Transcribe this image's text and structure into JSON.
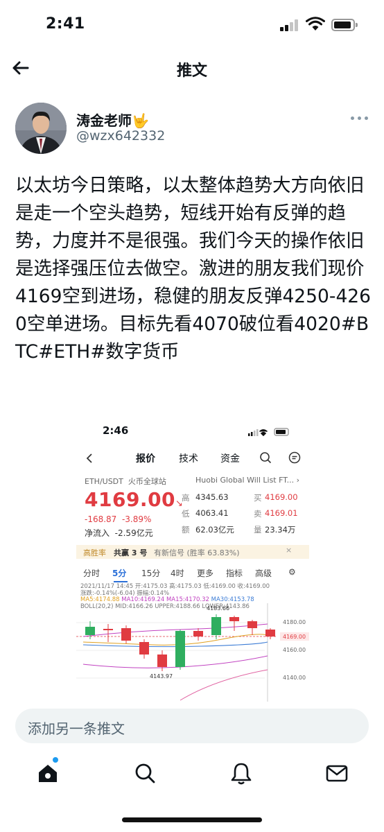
{
  "status_bar": {
    "time": "2:41"
  },
  "header": {
    "title": "推文"
  },
  "author": {
    "name": "涛金老师🤟",
    "handle": "@wzx642332"
  },
  "tweet": {
    "text": "以太坊今日策略，以太整体趋势大方向依旧是走一个空头趋势，短线开始有反弹的趋势，力度并不是很强。我们今天的操作依旧是选择强压位去做空。激进的朋友我们现价4169空到进场，稳健的朋友反弹4250-4260空单进场。目标先看4070破位看4020#BTC#ETH#数字货币"
  },
  "embedded_screenshot": {
    "time": "2:46",
    "nav": {
      "quote": "报价",
      "tech": "技术",
      "funds": "资金"
    },
    "pair": "ETH/USDT",
    "exchange": "火币全球站",
    "right_pair": "Huobi Global Will List FT...",
    "price": "4169.00",
    "price_arrow": "↘",
    "change_abs": "-168.87",
    "change_pct": "-3.89%",
    "inflow_label": "净流入",
    "inflow_value": "-2.59亿元",
    "stats": {
      "high_label": "高",
      "high": "4345.63",
      "buy_label": "买",
      "buy": "4169.00",
      "low_label": "低",
      "low": "4063.41",
      "sell_label": "卖",
      "sell": "4169.01",
      "amount_label": "额",
      "amount": "62.03亿元",
      "volume_label": "量",
      "volume": "23.34万"
    },
    "banner": {
      "tag": "高胜率",
      "text": "共赢 3 号",
      "note": "有新信号 (胜率 63.83%)"
    },
    "tabs": [
      "分时",
      "5分",
      "15分",
      "4时",
      "更多",
      "指标",
      "高级"
    ],
    "active_tab": "5分",
    "info_line1": "2021/11/17 14:45 开:4175.03 高:4175.03 低:4169.00 收:4169.00",
    "info_line2": "涨跌:-0.14%(-6.04) 振幅:0.14%",
    "info_ma5": "MA5:4174.88",
    "info_ma10": "MA10:4169.24",
    "info_ma15": "MA15:4170.32",
    "info_ma30": "MA30:4153.78",
    "info_boll": "BOLL(20,2) MID:4166.26 UPPER:4188.66 LOWER:4143.86",
    "chart_labels": {
      "high": "4183.66",
      "low": "4143.97",
      "y1": "4180.00",
      "current": "4169.00",
      "y2": "4160.00",
      "y3": "4140.00"
    }
  },
  "compose": {
    "placeholder": "添加另一条推文"
  },
  "tabbar": {
    "items": [
      "home-icon",
      "search-icon",
      "notifications-icon",
      "messages-icon"
    ]
  },
  "colors": {
    "accent": "#1d9bf0",
    "down": "#e03b41",
    "up": "#2fae5f"
  }
}
